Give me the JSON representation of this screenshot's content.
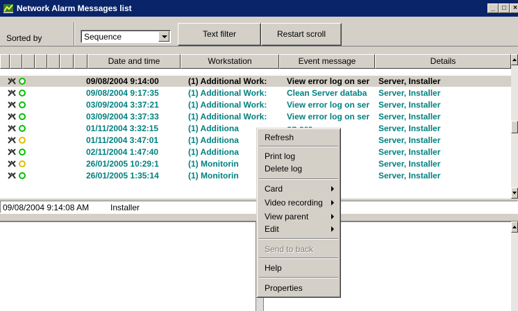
{
  "window": {
    "title": "Network Alarm Messages list",
    "controls": [
      "_",
      "□",
      "×"
    ]
  },
  "toolbar": {
    "sorted_label": "Sorted by",
    "sort_value": "Sequence",
    "text_filter_label": "Text filter",
    "restart_scroll_label": "Restart scroll"
  },
  "columns": [
    "Date and time",
    "Workstation",
    "Event message",
    "Details"
  ],
  "colors": {
    "black": "#000000",
    "teal": "#008080",
    "green_dot": "#00c000",
    "yellow_dot": "#e0c000",
    "titlebar": "#0a246a"
  },
  "rows": [
    {
      "date": "09/08/2004 9:14:00",
      "ws": "(1) Additional Work:",
      "ev": "View error log on ser",
      "det": "Server, Installer",
      "color": "#000000",
      "dot": "green",
      "selected": true
    },
    {
      "date": "09/08/2004 9:17:35",
      "ws": "(1) Additional Work:",
      "ev": "Clean Server databa",
      "det": "Server, Installer",
      "color": "#008080",
      "dot": "green",
      "selected": false
    },
    {
      "date": "03/09/2004 3:37:21",
      "ws": "(1) Additional Work:",
      "ev": "View error log on ser",
      "det": "Server, Installer",
      "color": "#008080",
      "dot": "green",
      "selected": false
    },
    {
      "date": "03/09/2004 3:37:33",
      "ws": "(1) Additional Work:",
      "ev": "View error log on ser",
      "det": "Server, Installer",
      "color": "#008080",
      "dot": "green",
      "selected": false
    },
    {
      "date": "01/11/2004 3:32:15",
      "ws": "(1) Additiona",
      "ev": "on ser",
      "det": "Server, Installer",
      "color": "#008080",
      "dot": "green",
      "selected": false
    },
    {
      "date": "01/11/2004 3:47:01",
      "ws": "(1) Additiona",
      "ev": "on ser",
      "det": "Server, Installer",
      "color": "#008080",
      "dot": "yellow",
      "selected": false
    },
    {
      "date": "02/11/2004 1:47:40",
      "ws": "(1) Additiona",
      "ev": "databa",
      "det": "Server, Installer",
      "color": "#008080",
      "dot": "green",
      "selected": false
    },
    {
      "date": "26/01/2005 10:29:1",
      "ws": "(1) Monitorin",
      "ev": "on ser",
      "det": "Server, Installer",
      "color": "#008080",
      "dot": "yellow",
      "selected": false
    },
    {
      "date": "26/01/2005 1:35:14",
      "ws": "(1) Monitorin",
      "ev": "on ser",
      "det": "Server, Installer",
      "color": "#008080",
      "dot": "green",
      "selected": false
    }
  ],
  "status": {
    "timestamp": "09/08/2004 9:14:08 AM",
    "user": "Installer"
  },
  "context_menu": {
    "refresh": "Refresh",
    "print_log": "Print log",
    "delete_log": "Delete log",
    "card": "Card",
    "video_recording": "Video recording",
    "view_parent": "View parent",
    "edit": "Edit",
    "send_to_back": "Send to back",
    "help": "Help",
    "properties": "Properties"
  }
}
